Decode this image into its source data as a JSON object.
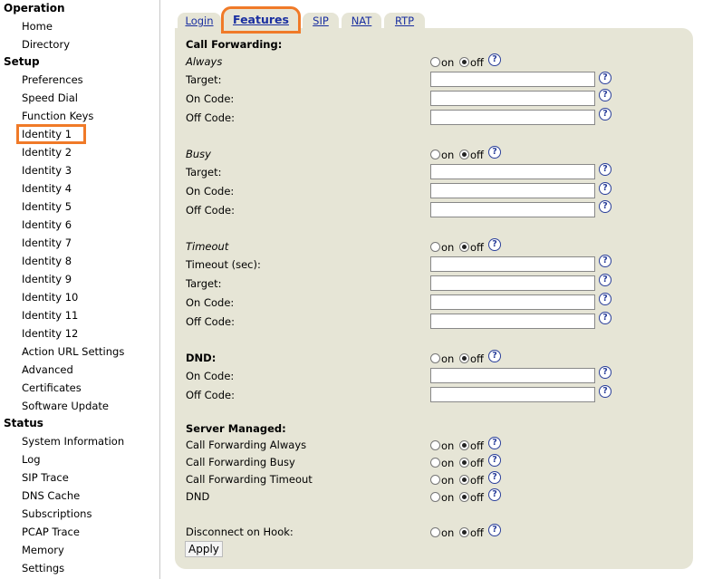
{
  "sidebar": {
    "sections": [
      {
        "title": "Operation",
        "items": [
          "Home",
          "Directory"
        ]
      },
      {
        "title": "Setup",
        "items": [
          "Preferences",
          "Speed Dial",
          "Function Keys",
          "Identity 1",
          "Identity 2",
          "Identity 3",
          "Identity 4",
          "Identity 5",
          "Identity 6",
          "Identity 7",
          "Identity 8",
          "Identity 9",
          "Identity 10",
          "Identity 11",
          "Identity 12",
          "Action URL Settings",
          "Advanced",
          "Certificates",
          "Software Update"
        ]
      },
      {
        "title": "Status",
        "items": [
          "System Information",
          "Log",
          "SIP Trace",
          "DNS Cache",
          "Subscriptions",
          "PCAP Trace",
          "Memory",
          "Settings"
        ]
      }
    ],
    "selected": "Identity 1"
  },
  "tabs": [
    "Login",
    "Features",
    "SIP",
    "NAT",
    "RTP"
  ],
  "active_tab": "Features",
  "form": {
    "call_forwarding_title": "Call Forwarding:",
    "always": {
      "label": "Always",
      "state": "off",
      "target_label": "Target:",
      "on_code_label": "On Code:",
      "off_code_label": "Off Code:"
    },
    "busy": {
      "label": "Busy",
      "state": "off",
      "target_label": "Target:",
      "on_code_label": "On Code:",
      "off_code_label": "Off Code:"
    },
    "timeout": {
      "label": "Timeout",
      "state": "off",
      "timeout_label": "Timeout (sec):",
      "target_label": "Target:",
      "on_code_label": "On Code:",
      "off_code_label": "Off Code:"
    },
    "dnd": {
      "label": "DND:",
      "state": "off",
      "on_code_label": "On Code:",
      "off_code_label": "Off Code:"
    },
    "server_managed": {
      "title": "Server Managed:",
      "items": [
        {
          "label": "Call Forwarding Always",
          "state": "off"
        },
        {
          "label": "Call Forwarding Busy",
          "state": "off"
        },
        {
          "label": "Call Forwarding Timeout",
          "state": "off"
        },
        {
          "label": "DND",
          "state": "off"
        }
      ]
    },
    "disconnect_on_hook": {
      "label": "Disconnect on Hook:",
      "state": "off"
    },
    "on_text": "on",
    "off_text": "off",
    "help_glyph": "?",
    "apply_label": "Apply"
  },
  "colors": {
    "panel": "#e6e5d6",
    "highlight": "#f07a28",
    "link": "#1a2fa0"
  }
}
